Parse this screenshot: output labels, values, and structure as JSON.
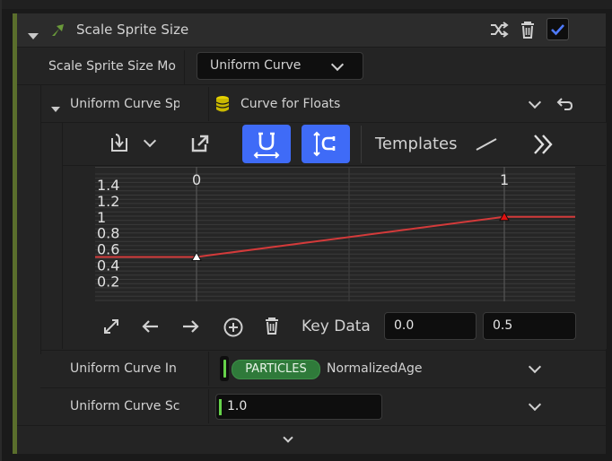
{
  "module": {
    "title": "Scale Sprite Size",
    "enabled": true
  },
  "rows": {
    "mode_label": "Scale Sprite Size Mo",
    "mode_value": "Uniform Curve",
    "curve_label": "Uniform Curve Sp",
    "curve_value": "Curve for Floats",
    "input_label": "Uniform Curve In",
    "input_badge": "PARTICLES",
    "input_value": "NormalizedAge",
    "scale_label": "Uniform Curve Sc",
    "scale_value": "1.0"
  },
  "toolbar": {
    "templates_label": "Templates"
  },
  "key_data": {
    "label": "Key Data",
    "time": "0.0",
    "value": "0.5"
  },
  "colors": {
    "accent": "#3f6bf7",
    "module_bar": "#5a6e2c",
    "curve": "#d33a3a",
    "badge": "#2f7a3a"
  },
  "icons": {
    "expand": "triangle-down-icon",
    "module": "green-arrow-icon",
    "shuffle": "shuffle-icon",
    "delete": "trash-icon",
    "enabled": "checkbox-icon",
    "database": "database-icon",
    "reset": "undo-icon",
    "import": "import-icon",
    "export": "export-icon",
    "snap_h": "magnet-horizontal-icon",
    "snap_v": "magnet-vertical-icon",
    "linear_template": "line-icon",
    "more": "double-chevron-right-icon",
    "fit": "fit-icon",
    "prev_key": "arrow-left-icon",
    "next_key": "arrow-right-icon",
    "add_key": "add-circle-icon",
    "delete_key": "trash-icon",
    "collapse": "chevron-down-icon"
  },
  "chart_data": {
    "type": "line",
    "series": [
      {
        "x": [
          0,
          1
        ],
        "values": [
          0.5,
          1.0
        ]
      }
    ],
    "extrapolation": "constant",
    "x_ticks": [
      "0",
      "1"
    ],
    "y_ticks": [
      "0.2",
      "0.4",
      "0.6",
      "0.8",
      "1",
      "1.2",
      "1.4"
    ],
    "xlim": [
      -0.33,
      0.21
    ],
    "ylim": [
      0.1,
      1.5
    ],
    "key_markers": [
      {
        "x": 0,
        "y": 0.5,
        "color": "white"
      },
      {
        "x": 1,
        "y": 1.0,
        "color": "red"
      }
    ]
  }
}
